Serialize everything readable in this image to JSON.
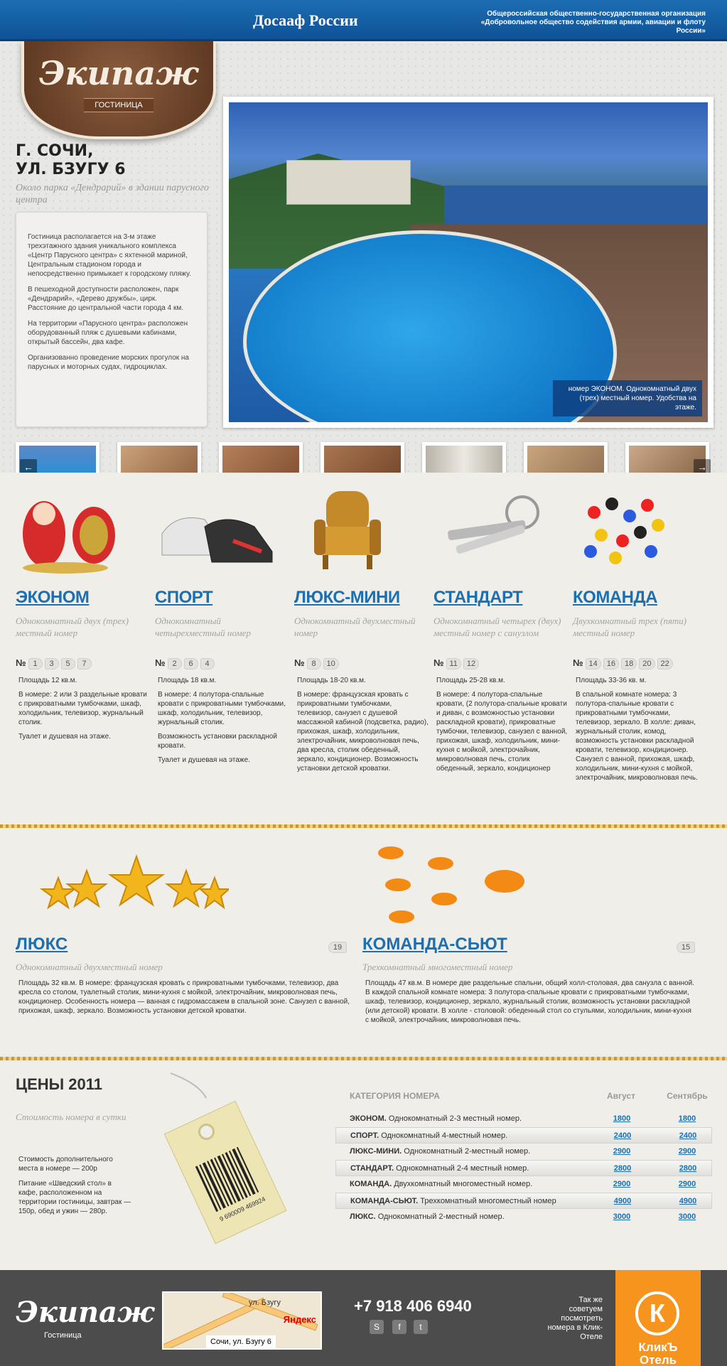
{
  "header": {
    "org_line1": "Общероссийская общественно-государственная организация",
    "org_line2": "«Добровольное общество содействия армии, авиации и флоту России»",
    "dosaaf": "Досааф России"
  },
  "logo": {
    "name": "Экипаж",
    "sub": "ГОСТИНИЦА"
  },
  "address": {
    "line1": "Г. СОЧИ,",
    "line2": "УЛ. БЗУГУ 6",
    "near": "Около парка «Дендрарий» в здании парусного центра"
  },
  "description": [
    "Гостиница располагается на 3-м этаже трехэтажного здания уникального комплекса «Центр Парусного центра» с яхтенной мариной, Центральным стадионом города и непосредственно примыкает к городскому пляжу.",
    "В пешеходной доступности расположен, парк «Дендрарий», «Дерево дружбы», цирк. Расстояние до центральной части города 4 км.",
    "На территории «Парусного центра» расположен оборудованный пляж с душевыми кабинами, открытый бассейн, два кафе.",
    "Организованно проведение морских прогулок на парусных и моторных судах, гидроциклах."
  ],
  "photo_caption": "номер ЭКОНОМ. Однокомнатный двух (трех) местный номер. Удобства на этаже.",
  "rooms": [
    {
      "name": "ЭКОНОМ",
      "sub": "Однокомнатный двух (трех) местный номер",
      "nums": [
        "1",
        "3",
        "5",
        "7"
      ],
      "text": [
        "Площадь 12 кв.м.",
        "В номере: 2 или 3 раздельные кровати с прикроватными тумбочками, шкаф, холодильник, телевизор, журнальный столик.",
        "Туалет и душевая на этаже."
      ]
    },
    {
      "name": "СПОРТ",
      "sub": "Однокомнатный четырехместный номер",
      "nums": [
        "2",
        "6",
        "4"
      ],
      "text": [
        "Площадь 18 кв.м.",
        "В номере: 4 полутора-спальные кровати с прикроватными тумбочками, шкаф, холодильник, телевизор, журнальный столик.",
        "Возможность установки раскладной кровати.",
        "Туалет и душевая на этаже."
      ]
    },
    {
      "name": "ЛЮКС-МИНИ",
      "sub": "Однокомнатный двухместный номер",
      "nums": [
        "8",
        "10"
      ],
      "text": [
        "Площадь 18-20 кв.м.",
        "В номере: французская кровать с прикроватными тумбочками, телевизор, санузел с душевой массажной кабиной (подсветка, радио), прихожая, шкаф, холодильник, электрочайник, микроволновая печь, два кресла, столик обеденный, зеркало, кондиционер. Возможность установки детской кроватки."
      ]
    },
    {
      "name": "СТАНДАРТ",
      "sub": "Однокомнатный четырех (двух) местный номер с санузлом",
      "nums": [
        "11",
        "12"
      ],
      "text": [
        "Площадь 25-28 кв.м.",
        "В номере: 4 полутора-спальные кровати, (2 полутора-спальные кровати и диван, с возможностью установки раскладной кровати), прикроватные тумбочки, телевизор, санузел с ванной, прихожая, шкаф, холодильник, мини-кухня с мойкой, электрочайник, микроволновая печь, столик обеденный, зеркало, кондиционер"
      ]
    },
    {
      "name": "КОМАНДА",
      "sub": "Двухкомнатный трех (пяти) местный номер",
      "nums": [
        "14",
        "16",
        "18",
        "20",
        "22"
      ],
      "text": [
        "Площадь 33-36 кв. м.",
        "В спальной комнате номера: 3 полутора-спальные кровати с прикроватными тумбочками, телевизор, зеркало. В холле: диван, журнальный столик, комод, возможность установки раскладной кровати, телевизор, кондиционер. Санузел с ванной, прихожая, шкаф, холодильник, мини-кухня с мойкой, электрочайник, микроволновая печь."
      ]
    }
  ],
  "lux": [
    {
      "name": "ЛЮКС",
      "badge": "19",
      "sub": "Однокомнатный двухместный номер",
      "text": "Площадь 32 кв.м. В номере: французская кровать с прикроватными тумбочками, телевизор, два кресла со столом, туалетный столик, мини-кухня с мойкой, электрочайник, микроволновая печь, кондиционер. Особенность номера — ванная с гидромассажем в спальной зоне. Санузел с ванной, прихожая, шкаф, зеркало. Возможность установки детской кроватки."
    },
    {
      "name": "КОМАНДА-СЬЮТ",
      "badge": "15",
      "sub": "Трехкомнатный многоместный номер",
      "text": "Площадь 47 кв.м. В номере две раздельные спальни, общий холл-столовая, два санузла с ванной. В каждой спальной комнате номера: 3 полутора-спальные кровати с прикроватными тумбочками, шкаф, телевизор, кондиционер, зеркало, журнальный столик, возможность установки раскладной (или детской) кровати. В холле - столовой: обеденный стол со стульями, холодильник, мини-кухня с мойкой, электрочайник, микроволновая печь."
    }
  ],
  "prices": {
    "title": "ЦЕНЫ 2011",
    "sub": "Стоимость номера в сутки",
    "note1": "Стоимость дополнительного места в номере — 200р",
    "note2": "Питание «Шведский стол» в кафе, расположенном на территории гостиницы, завтрак — 150р, обед и ужин — 280р.",
    "col_category": "КАТЕГОРИЯ НОМЕРА",
    "col_aug": "Август",
    "col_sep": "Сентябрь",
    "barcode": "9 690009 469924",
    "rows": [
      {
        "cat": "ЭКОНОМ.",
        "desc": "Однокомнатный 2-3 местный номер.",
        "aug": "1800",
        "sep": "1800"
      },
      {
        "cat": "СПОРТ.",
        "desc": "Однокомнатный 4-местный номер.",
        "aug": "2400",
        "sep": "2400"
      },
      {
        "cat": "ЛЮКС-МИНИ.",
        "desc": "Однокомнатный 2-местный номер.",
        "aug": "2900",
        "sep": "2900"
      },
      {
        "cat": "СТАНДАРТ.",
        "desc": "Однокомнатный 2-4 местный номер.",
        "aug": "2800",
        "sep": "2800"
      },
      {
        "cat": "КОМАНДА.",
        "desc": "Двухкомнатный многоместный номер.",
        "aug": "2900",
        "sep": "2900"
      },
      {
        "cat": "КОМАНДА-СЬЮТ.",
        "desc": "Трехкомнатный многоместный номер",
        "aug": "4900",
        "sep": "4900"
      },
      {
        "cat": "ЛЮКС.",
        "desc": "Однокомнатный 2-местный номер.",
        "aug": "3000",
        "sep": "3000"
      }
    ]
  },
  "footer": {
    "logo": "Экипаж",
    "logo_sub": "Гостиница",
    "map_label": "Сочи, ул. Бзугу 6",
    "map_street": "ул. Бзугу",
    "map_brand": "Яндекс",
    "phone": "+7 918 406 6940",
    "recommend": "Так же советуем посмотреть номера в Клик-Отеле",
    "klik_letter": "К",
    "klik_line1": "КликЪ",
    "klik_line2": "Отель"
  }
}
